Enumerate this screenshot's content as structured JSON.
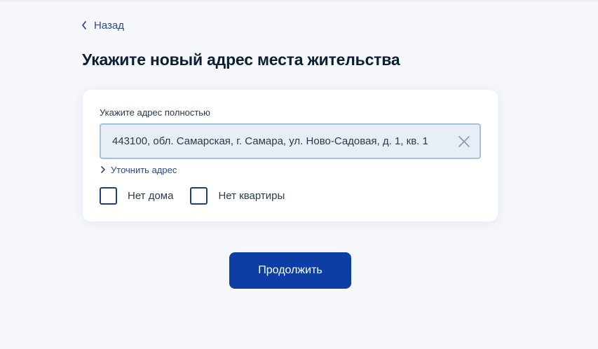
{
  "nav": {
    "back_label": "Назад"
  },
  "page": {
    "title": "Укажите новый адрес места жительства"
  },
  "address_form": {
    "field_label": "Укажите адрес полностью",
    "address_value": "443100, обл. Самарская, г. Самара, ул. Ново-Садовая, д. 1, кв. 1",
    "refine_label": "Уточнить адрес",
    "checkboxes": [
      {
        "label": "Нет дома",
        "checked": false
      },
      {
        "label": "Нет квартиры",
        "checked": false
      }
    ]
  },
  "actions": {
    "continue_label": "Продолжить"
  },
  "colors": {
    "primary": "#0d3ea5",
    "link": "#2c4b86",
    "background": "#f5f7fb",
    "input_background": "#e8eef6",
    "input_border": "#a9c0dc"
  },
  "icons": [
    "chevron-left-icon",
    "close-icon",
    "chevron-right-icon"
  ]
}
